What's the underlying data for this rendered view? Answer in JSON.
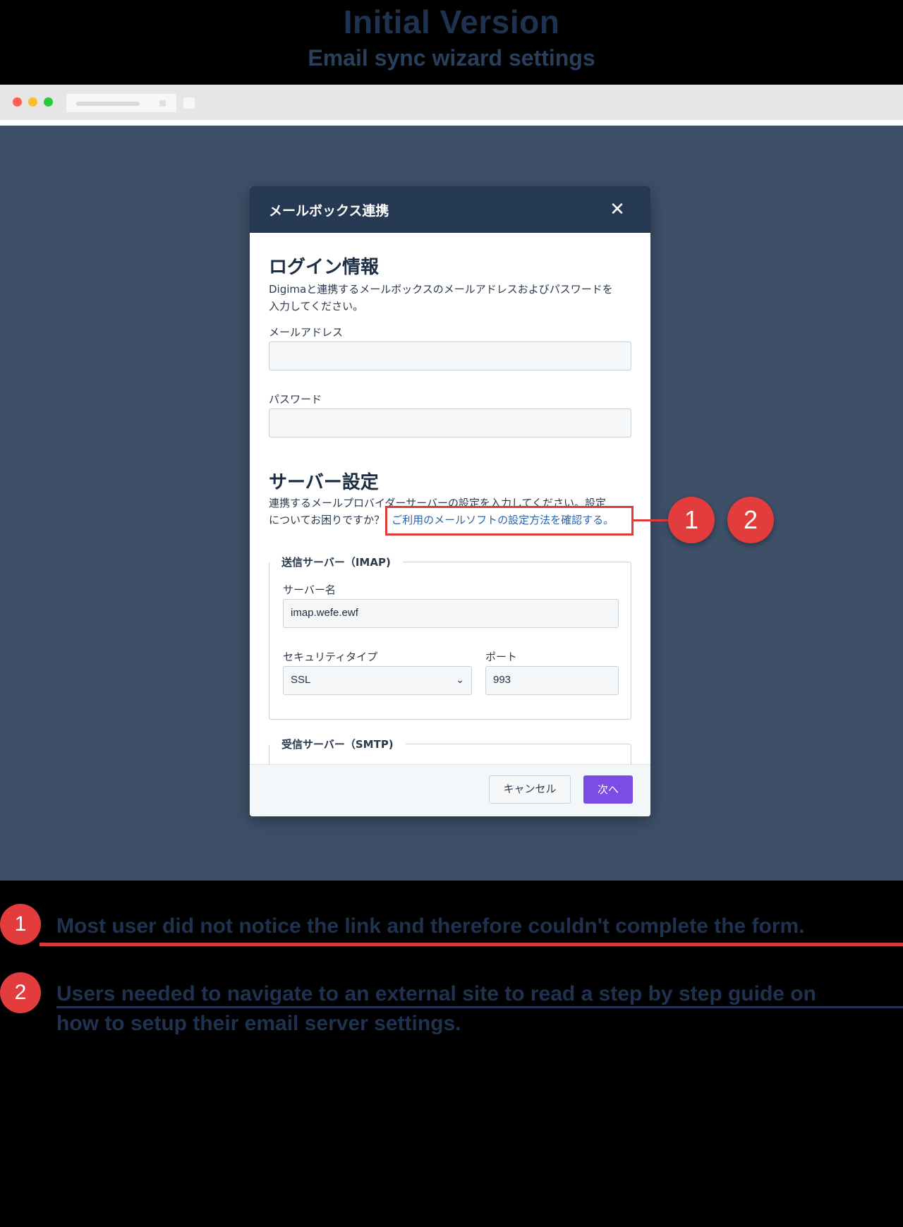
{
  "header": {
    "title": "Initial Version",
    "subtitle": "Email sync wizard settings"
  },
  "colors": {
    "accent_primary": "#7b4ce6",
    "modal_header": "#253a52",
    "page_background": "#3d5068",
    "annotation_red": "#e03b3b",
    "link": "#2a63a8"
  },
  "modal": {
    "title": "メールボックス連携",
    "close_icon": "close-icon",
    "login": {
      "heading": "ログイン情報",
      "description_line1": "Digimaと連携するメールボックスのメールアドレスおよびパスワードを",
      "description_line2": "入力してください。",
      "email_label": "メールアドレス",
      "email_value": "",
      "password_label": "パスワード",
      "password_value": ""
    },
    "server": {
      "heading": "サーバー設定",
      "description_line1": "連携するメールプロバイダーサーバーの設定を入力してください。設定",
      "description_line2": "についてお困りですか？",
      "help_link": "ご利用のメールソフトの設定方法を確認する。",
      "imap": {
        "legend": "送信サーバー（IMAP)",
        "server_name_label": "サーバー名",
        "server_name_value": "imap.wefe.ewf",
        "security_label": "セキュリティタイプ",
        "security_value": "SSL",
        "port_label": "ポート",
        "port_value": "993"
      },
      "smtp": {
        "legend": "受信サーバー（SMTP)"
      }
    },
    "footer": {
      "cancel_label": "キャンセル",
      "next_label": "次へ"
    }
  },
  "annotations": [
    {
      "number": "1",
      "text": "Most user did not notice the link and therefore couldn't complete the form."
    },
    {
      "number": "2",
      "text_line1": "Users needed to navigate to an external site to read a step by step guide on",
      "text_line2": "how to setup their email server settings."
    }
  ]
}
